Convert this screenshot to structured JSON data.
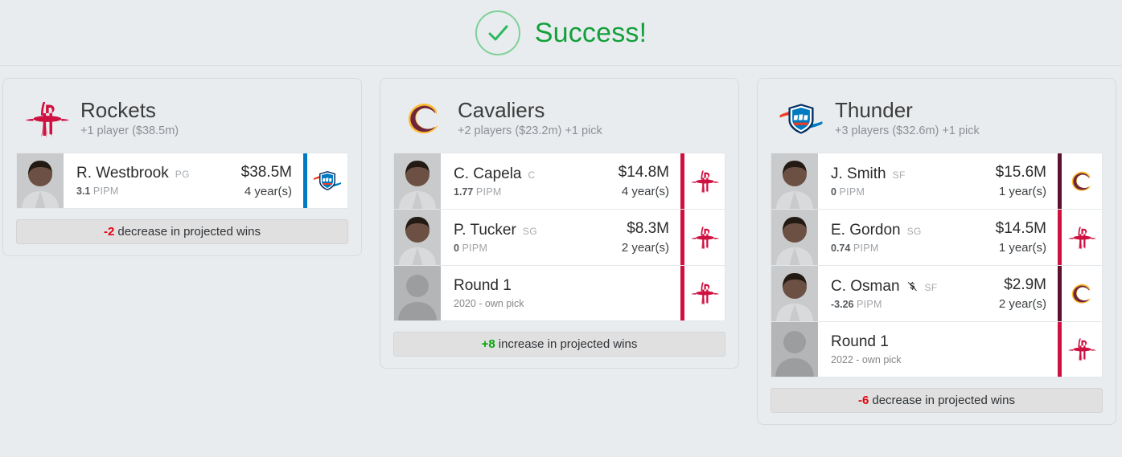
{
  "banner": {
    "icon": "check-circle-icon",
    "text": "Success!",
    "color": "#14a03c"
  },
  "colors": {
    "rockets": "#ce1141",
    "cavaliers": "#5c122e",
    "thunder": "#007ac1",
    "positive": "#07a507",
    "negative": "#e8000d",
    "page_background": "#e9ecee"
  },
  "cards": [
    {
      "team": "Rockets",
      "logo": "rockets-logo",
      "summary": "+1 player ($38.5m)",
      "assets": [
        {
          "type": "player",
          "name": "R. Westbrook",
          "position": "PG",
          "pipm_value": "3.1",
          "pipm_label": "PIPM",
          "salary": "$38.5M",
          "years": "4 year(s)",
          "from_team": "Thunder",
          "from_logo": "thunder-logo",
          "accent": "#007ac1",
          "non_guaranteed": false
        }
      ],
      "wins": {
        "delta": "-2",
        "direction": "negative",
        "text": "decrease in projected wins"
      }
    },
    {
      "team": "Cavaliers",
      "logo": "cavaliers-logo",
      "summary": "+2 players ($23.2m) +1 pick",
      "assets": [
        {
          "type": "player",
          "name": "C. Capela",
          "position": "C",
          "pipm_value": "1.77",
          "pipm_label": "PIPM",
          "salary": "$14.8M",
          "years": "4 year(s)",
          "from_team": "Rockets",
          "from_logo": "rockets-logo",
          "accent": "#ce1141",
          "non_guaranteed": false
        },
        {
          "type": "player",
          "name": "P. Tucker",
          "position": "SG",
          "pipm_value": "0",
          "pipm_label": "PIPM",
          "salary": "$8.3M",
          "years": "2 year(s)",
          "from_team": "Rockets",
          "from_logo": "rockets-logo",
          "accent": "#ce1141",
          "non_guaranteed": false
        },
        {
          "type": "pick",
          "name": "Round 1",
          "detail": "2020 - own pick",
          "from_team": "Rockets",
          "from_logo": "rockets-logo",
          "accent": "#ce1141"
        }
      ],
      "wins": {
        "delta": "+8",
        "direction": "positive",
        "text": "increase in projected wins"
      }
    },
    {
      "team": "Thunder",
      "logo": "thunder-logo",
      "summary": "+3 players ($32.6m) +1 pick",
      "assets": [
        {
          "type": "player",
          "name": "J. Smith",
          "position": "SF",
          "pipm_value": "0",
          "pipm_label": "PIPM",
          "salary": "$15.6M",
          "years": "1 year(s)",
          "from_team": "Cavaliers",
          "from_logo": "cavaliers-logo",
          "accent": "#5c122e",
          "non_guaranteed": false
        },
        {
          "type": "player",
          "name": "E. Gordon",
          "position": "SG",
          "pipm_value": "0.74",
          "pipm_label": "PIPM",
          "salary": "$14.5M",
          "years": "1 year(s)",
          "from_team": "Rockets",
          "from_logo": "rockets-logo",
          "accent": "#ce1141",
          "non_guaranteed": false
        },
        {
          "type": "player",
          "name": "C. Osman",
          "position": "SF",
          "pipm_value": "-3.26",
          "pipm_label": "PIPM",
          "salary": "$2.9M",
          "years": "2 year(s)",
          "from_team": "Cavaliers",
          "from_logo": "cavaliers-logo",
          "accent": "#5c122e",
          "non_guaranteed": true,
          "non_guaranteed_icon": "money-off-icon"
        },
        {
          "type": "pick",
          "name": "Round 1",
          "detail": "2022 - own pick",
          "from_team": "Rockets",
          "from_logo": "rockets-logo",
          "accent": "#ce1141"
        }
      ],
      "wins": {
        "delta": "-6",
        "direction": "negative",
        "text": "decrease in projected wins"
      }
    }
  ]
}
